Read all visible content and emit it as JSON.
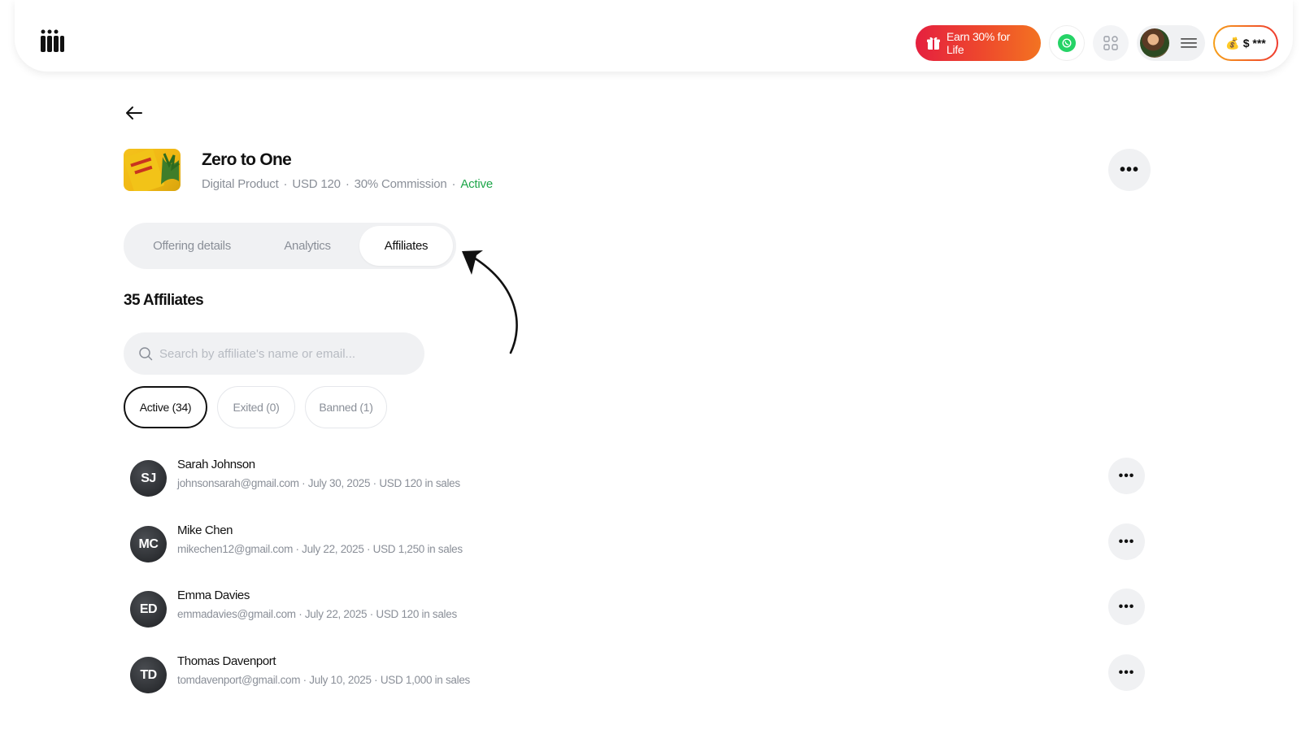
{
  "header": {
    "earn_label": "Earn 30% for Life",
    "wallet_label": "$ ***",
    "brand_gradient": [
      "#e5203f",
      "#f37321"
    ]
  },
  "product": {
    "title": "Zero to One",
    "type": "Digital Product",
    "price": "USD 120",
    "commission": "30% Commission",
    "status": "Active",
    "status_color": "#1ea64a"
  },
  "tabs": [
    {
      "label": "Offering details"
    },
    {
      "label": "Analytics"
    },
    {
      "label": "Affiliates"
    }
  ],
  "affiliates_section": {
    "count_title": "35 Affiliates",
    "search_placeholder": "Search by affiliate's name or email...",
    "filters": [
      {
        "label": "Active (34)"
      },
      {
        "label": "Exited (0)"
      },
      {
        "label": "Banned (1)"
      }
    ]
  },
  "affiliates": [
    {
      "initials": "SJ",
      "name": "Sarah Johnson",
      "email": "johnsonsarah@gmail.com",
      "date": "July 30, 2025",
      "sales": "USD 120 in sales"
    },
    {
      "initials": "MC",
      "name": "Mike Chen",
      "email": "mikechen12@gmail.com",
      "date": "July 22, 2025",
      "sales": "USD 1,250 in sales"
    },
    {
      "initials": "ED",
      "name": "Emma Davies",
      "email": "emmadavies@gmail.com",
      "date": "July 22, 2025",
      "sales": "USD 120 in sales"
    },
    {
      "initials": "TD",
      "name": "Thomas Davenport",
      "email": "tomdavenport@gmail.com",
      "date": "July 10, 2025",
      "sales": "USD 1,000 in sales"
    }
  ],
  "icons": {
    "logo": "brand-logo-icon",
    "gift": "gift-icon",
    "whatsapp": "whatsapp-icon",
    "apps": "apps-grid-icon",
    "menu": "hamburger-menu-icon",
    "back": "back-arrow-icon",
    "search": "search-icon",
    "more": "more-dots-icon"
  }
}
